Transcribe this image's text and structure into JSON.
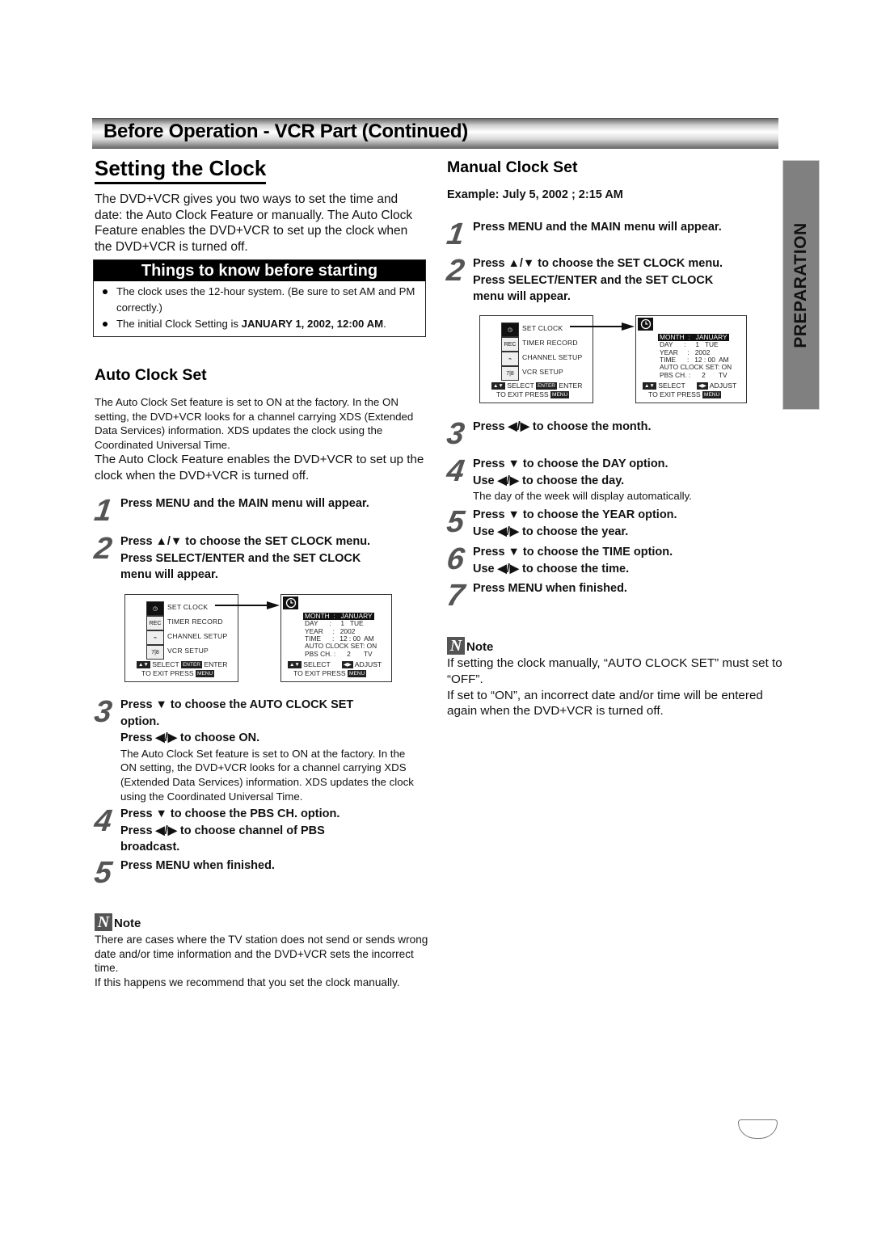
{
  "header": {
    "title": "Before Operation - VCR Part (Continued)"
  },
  "section": {
    "title": "Setting the Clock",
    "intro": "The DVD+VCR gives you two ways to set the time and date: the Auto Clock Feature or manually. The Auto Clock Feature enables the DVD+VCR to set up the clock when the DVD+VCR is turned off."
  },
  "things_box": {
    "title": "Things to know before starting",
    "items": [
      {
        "text": "The clock uses the 12-hour system. (Be sure to set AM and PM correctly.)",
        "bold": ""
      },
      {
        "text": "The initial Clock Setting is ",
        "bold": "JANUARY 1, 2002, 12:00 AM",
        "tail": "."
      }
    ]
  },
  "auto": {
    "title": "Auto Clock Set",
    "para1": "The Auto Clock Set feature is set to ON at the factory. In the ON setting, the DVD+VCR looks for a channel carrying XDS (Extended Data Services) information. XDS updates the clock using the Coordinated Universal Time.",
    "para2": "The Auto Clock Feature enables the DVD+VCR to set up the clock when the DVD+VCR is turned off.",
    "steps": [
      {
        "num": "1",
        "lines": [
          "Press MENU and the MAIN menu will appear."
        ]
      },
      {
        "num": "2",
        "lines": [
          "Press ▲/▼ to choose the SET CLOCK menu.",
          "Press SELECT/ENTER and the SET CLOCK",
          "menu will appear."
        ]
      },
      {
        "num": "3",
        "lines": [
          "Press ▼ to choose the AUTO CLOCK SET",
          "option.",
          "Press ◀/▶ to choose ON."
        ],
        "sub": "The Auto Clock Set feature is set to ON at the factory. In the ON setting, the DVD+VCR looks for a channel carrying XDS (Extended Data Services) information. XDS updates the clock using the Coordinated Universal Time."
      },
      {
        "num": "4",
        "lines": [
          "Press ▼ to choose the PBS CH. option.",
          "Press ◀/▶ to choose channel of PBS",
          "broadcast."
        ]
      },
      {
        "num": "5",
        "lines": [
          "Press MENU when finished."
        ]
      }
    ],
    "note": {
      "label": "Note",
      "lines": [
        "There are cases where the TV station does not send or sends wrong date and/or time information and the DVD+VCR sets the incorrect time.",
        "If this happens we recommend that you set the clock manually."
      ]
    }
  },
  "manual": {
    "title": "Manual Clock Set",
    "example": "Example: July 5, 2002 ;  2:15 AM",
    "steps": [
      {
        "num": "1",
        "lines": [
          "Press MENU and the MAIN menu will appear."
        ]
      },
      {
        "num": "2",
        "lines": [
          "Press ▲/▼ to choose the SET CLOCK menu.",
          "Press SELECT/ENTER and the SET CLOCK",
          "menu will appear."
        ]
      },
      {
        "num": "3",
        "lines": [
          "Press ◀/▶ to choose the month."
        ]
      },
      {
        "num": "4",
        "lines": [
          "Press ▼ to choose the DAY option.",
          "Use ◀/▶ to choose the day."
        ],
        "sub": "The day of the week will display automatically."
      },
      {
        "num": "5",
        "lines": [
          "Press ▼ to choose the YEAR option.",
          "Use ◀/▶ to choose the year."
        ]
      },
      {
        "num": "6",
        "lines": [
          "Press ▼ to choose the TIME option.",
          "Use ◀/▶ to choose the time."
        ]
      },
      {
        "num": "7",
        "lines": [
          "Press MENU when finished."
        ]
      }
    ],
    "note": {
      "label": "Note",
      "lines": [
        "If setting the clock manually, “AUTO CLOCK SET” must set to “OFF”.",
        "If set to “ON”, an incorrect date and/or time will be entered again when the DVD+VCR is turned off."
      ]
    }
  },
  "osd": {
    "main_menu": {
      "items": [
        "SET  CLOCK",
        "TIMER RECORD",
        "CHANNEL  SETUP",
        "VCR SETUP"
      ],
      "icons": [
        "clock-icon",
        "timer-record-icon",
        "channel-setup-icon",
        "vcr-setup-icon"
      ],
      "icon_glyphs": [
        "◷",
        "REC",
        "⌁",
        "7|8"
      ],
      "footer_line1_left": "SELECT",
      "footer_key": "ENTER",
      "footer_line1_right": "ENTER",
      "footer_line2": "TO  EXIT   PRESS",
      "footer_menu_key": "MENU",
      "nav_keys": "▲▼"
    },
    "clock_menu": {
      "rows": [
        "MONTH  :   JANUARY",
        "DAY      :     1   TUE",
        "YEAR     :   2002",
        "TIME      :   12 : 00  AM",
        "AUTO CLOCK SET: ON",
        "PBS CH. :      2       TV"
      ],
      "highlighted_row": 0,
      "footer_line1_left": "SELECT",
      "footer_line1_right": "ADJUST",
      "adjust_keys": "◀▶",
      "nav_keys": "▲▼",
      "footer_line2": "TO  EXIT   PRESS",
      "footer_menu_key": "MENU"
    }
  },
  "side_tab": {
    "label": "PREPARATION"
  }
}
